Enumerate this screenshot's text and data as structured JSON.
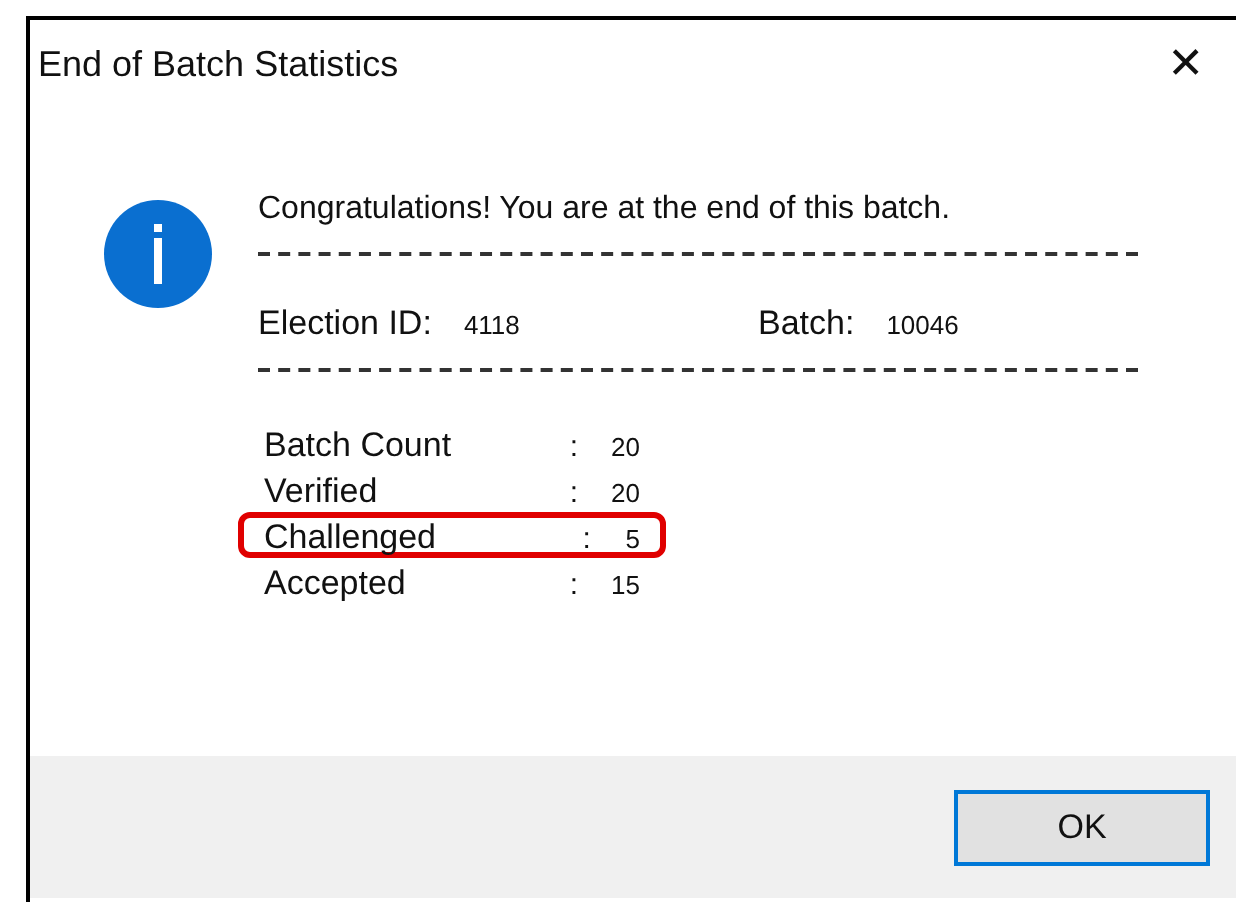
{
  "window": {
    "title": "End of Batch Statistics",
    "close": "✕"
  },
  "message": "Congratulations! You are at the end of this batch.",
  "ids": [
    {
      "label": "Election ID:",
      "value": "4118"
    },
    {
      "label": "Batch:",
      "value": "10046"
    }
  ],
  "stats": [
    {
      "label": "Batch Count",
      "sep": ":",
      "value": "20",
      "highlighted": false
    },
    {
      "label": "Verified",
      "sep": ":",
      "value": "20",
      "highlighted": false
    },
    {
      "label": "Challenged",
      "sep": ":",
      "value": "5",
      "highlighted": true
    },
    {
      "label": "Accepted",
      "sep": ":",
      "value": "15",
      "highlighted": false
    }
  ],
  "buttons": [
    {
      "label": "OK"
    }
  ]
}
